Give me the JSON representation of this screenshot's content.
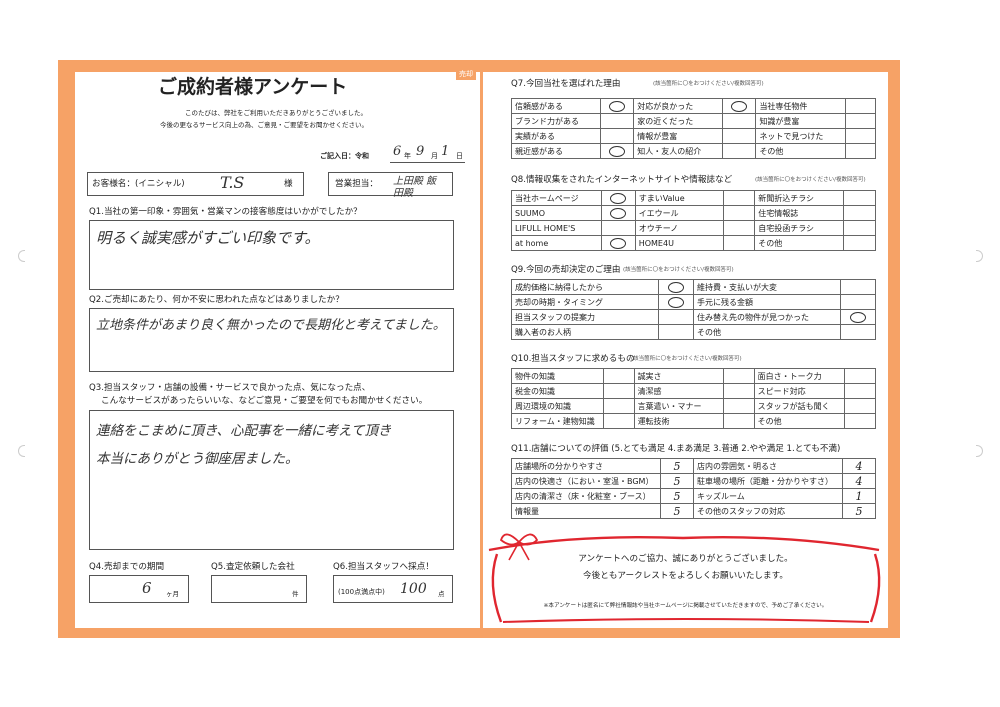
{
  "left": {
    "corner_tag": "売却",
    "title": "ご成約者様アンケート",
    "intro_1": "このたびは、弊社をご利用いただきありがとうございました。",
    "intro_2": "今後の更なるサービス向上の為、ご意見・ご要望をお聞かせください。",
    "date_label": "ご記入日：令和",
    "date_values": {
      "year": "6",
      "month": "9",
      "day": "1"
    },
    "date_units": {
      "year": "年",
      "month": "月",
      "day": "日"
    },
    "customer_label": "お客様名：(イニシャル)",
    "customer_value": "T.S",
    "customer_suffix": "様",
    "staff_label": "営業担当：",
    "staff_value": "上田殿 飯田殿",
    "q1": "Q1.当社の第一印象・雰囲気・営業マンの接客態度はいかがでしたか？",
    "a1": "明るく誠実感がすごい印象です。",
    "q2": "Q2.ご売却にあたり、何か不安に思われた点などはありましたか？",
    "a2": "立地条件があまり良く無かったので長期化と考えてました。",
    "q3_1": "Q3.担当スタッフ・店舗の設備・サービスで良かった点、気になった点、",
    "q3_2": "こんなサービスがあったらいいな、などご意見・ご要望を何でもお聞かせください。",
    "a3_1": "連絡をこまめに頂き、心配事を一緒に考えて頂き",
    "a3_2": "本当にありがとう御座居ました。",
    "q4": "Q4.売却までの期間",
    "q4_value": "6",
    "q4_unit": "ヶ月",
    "q5": "Q5.査定依頼した会社",
    "q5_unit": "件",
    "q6": "Q6.担当スタッフへ採点！",
    "q6_caption": "(100点満点中)",
    "q6_value": "100",
    "q6_unit": "点"
  },
  "q7": {
    "title": "Q7.今回当社を選ばれた理由",
    "note": "(該当箇所に〇をおつけください/複数回答可)",
    "rows": [
      [
        {
          "label": "信頼感がある",
          "mark": true
        },
        {
          "label": "対応が良かった",
          "mark": true
        },
        {
          "label": "当社専任物件",
          "mark": false
        }
      ],
      [
        {
          "label": "ブランド力がある",
          "mark": false
        },
        {
          "label": "家の近くだった",
          "mark": false
        },
        {
          "label": "知識が豊富",
          "mark": false
        }
      ],
      [
        {
          "label": "実績がある",
          "mark": false
        },
        {
          "label": "情報が豊富",
          "mark": false
        },
        {
          "label": "ネットで見つけた",
          "mark": false
        }
      ],
      [
        {
          "label": "親近感がある",
          "mark": true
        },
        {
          "label": "知人・友人の紹介",
          "mark": false
        },
        {
          "label": "その他",
          "mark": false
        }
      ]
    ]
  },
  "q8": {
    "title": "Q8.情報収集をされたインターネットサイトや情報誌など",
    "note": "(該当箇所に〇をおつけください/複数回答可)",
    "rows": [
      [
        {
          "label": "当社ホームページ",
          "mark": true
        },
        {
          "label": "すまいValue",
          "mark": false
        },
        {
          "label": "新聞折込チラシ",
          "mark": false
        }
      ],
      [
        {
          "label": "SUUMO",
          "mark": true
        },
        {
          "label": "イエウール",
          "mark": false
        },
        {
          "label": "住宅情報誌",
          "mark": false
        }
      ],
      [
        {
          "label": "LIFULL HOME'S",
          "mark": false
        },
        {
          "label": "オウチーノ",
          "mark": false
        },
        {
          "label": "自宅投函チラシ",
          "mark": false
        }
      ],
      [
        {
          "label": "at home",
          "mark": true
        },
        {
          "label": "HOME4U",
          "mark": false
        },
        {
          "label": "その他",
          "mark": false
        }
      ]
    ]
  },
  "q9": {
    "title": "Q9.今回の売却決定のご理由",
    "note": "(該当箇所に〇をおつけください/複数回答可)",
    "rows": [
      [
        {
          "label": "成約価格に納得したから",
          "mark": true
        },
        {
          "label": "維持費・支払いが大変",
          "mark": false
        }
      ],
      [
        {
          "label": "売却の時期・タイミング",
          "mark": true
        },
        {
          "label": "手元に残る金額",
          "mark": false
        }
      ],
      [
        {
          "label": "担当スタッフの提案力",
          "mark": false
        },
        {
          "label": "住み替え先の物件が見つかった",
          "mark": true
        }
      ],
      [
        {
          "label": "購入者のお人柄",
          "mark": false
        },
        {
          "label": "その他",
          "mark": false
        }
      ]
    ]
  },
  "q10": {
    "title": "Q10.担当スタッフに求めるもの",
    "note": "(該当箇所に〇をおつけください/複数回答可)",
    "rows": [
      [
        "物件の知識",
        "誠実さ",
        "面白さ・トーク力"
      ],
      [
        "税金の知識",
        "清潔感",
        "スピード対応"
      ],
      [
        "周辺環境の知識",
        "言葉遣い・マナー",
        "スタッフが話も聞く"
      ],
      [
        "リフォーム・建物知識",
        "運転技術",
        "その他"
      ]
    ]
  },
  "q11": {
    "title": "Q11.店舗についての評価 (5.とても満足 4.まあ満足 3.普通 2.やや満足 1.とても不満)",
    "rows": [
      [
        {
          "label": "店舗場所の分かりやすさ",
          "score": "5"
        },
        {
          "label": "店内の雰囲気・明るさ",
          "score": "4"
        }
      ],
      [
        {
          "label": "店内の快適さ（におい・室温・BGM）",
          "score": "5"
        },
        {
          "label": "駐車場の場所（距離・分かりやすさ）",
          "score": "4"
        }
      ],
      [
        {
          "label": "店内の清潔さ（床・化粧室・ブース）",
          "score": "5"
        },
        {
          "label": "キッズルーム",
          "score": "1"
        }
      ],
      [
        {
          "label": "情報量",
          "score": "5"
        },
        {
          "label": "その他のスタッフの対応",
          "score": "5"
        }
      ]
    ]
  },
  "closing": {
    "line1": "アンケートへのご協力、誠にありがとうございました。",
    "line2": "今後ともアークレストをよろしくお願いいたします。",
    "footnote": "※本アンケートは匿名にて弊社情報誌や当社ホームページに掲載させていただきますので、予めご了承ください。"
  },
  "colors": {
    "frame": "#f6a266",
    "ribbon": "#e0262f"
  }
}
